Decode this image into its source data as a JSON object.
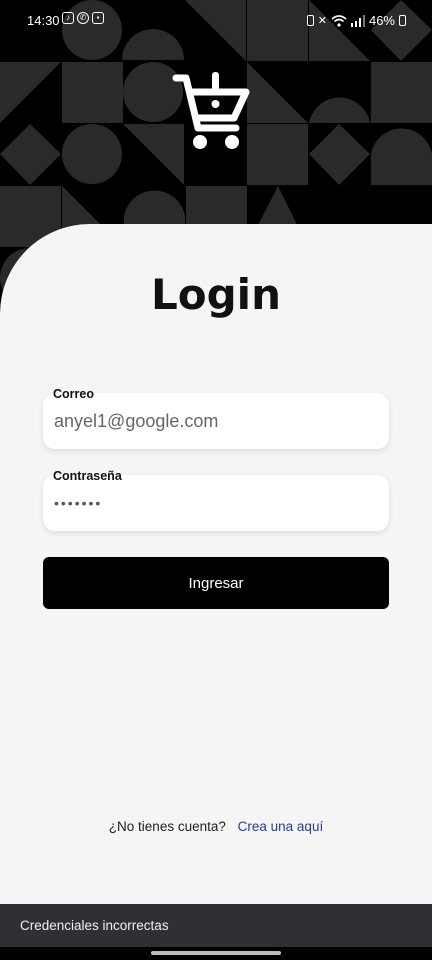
{
  "status_bar": {
    "time": "14:30",
    "left_icons": [
      "tiktok-icon",
      "whatsapp-icon",
      "app-notification-icon"
    ],
    "right_icons": [
      "battery-saver-icon",
      "mute-icon",
      "wifi-icon",
      "signal-icon"
    ],
    "battery": "46%"
  },
  "header": {
    "logo": "cart-alert-icon"
  },
  "login": {
    "title": "Login",
    "email_label": "Correo",
    "email_value": "anyel1@google.com",
    "password_label": "Contraseña",
    "password_value": "•••••••",
    "submit_label": "Ingresar"
  },
  "signup": {
    "question": "¿No tienes cuenta?",
    "link": "Crea una aquí"
  },
  "snackbar": {
    "message": "Credenciales incorrectas"
  },
  "colors": {
    "background_pattern": "#000000",
    "pattern_shape": "#2a2a2a",
    "card": "#f5f5f5",
    "button": "#000000",
    "link": "#2a3d8f",
    "snackbar": "#303034"
  }
}
